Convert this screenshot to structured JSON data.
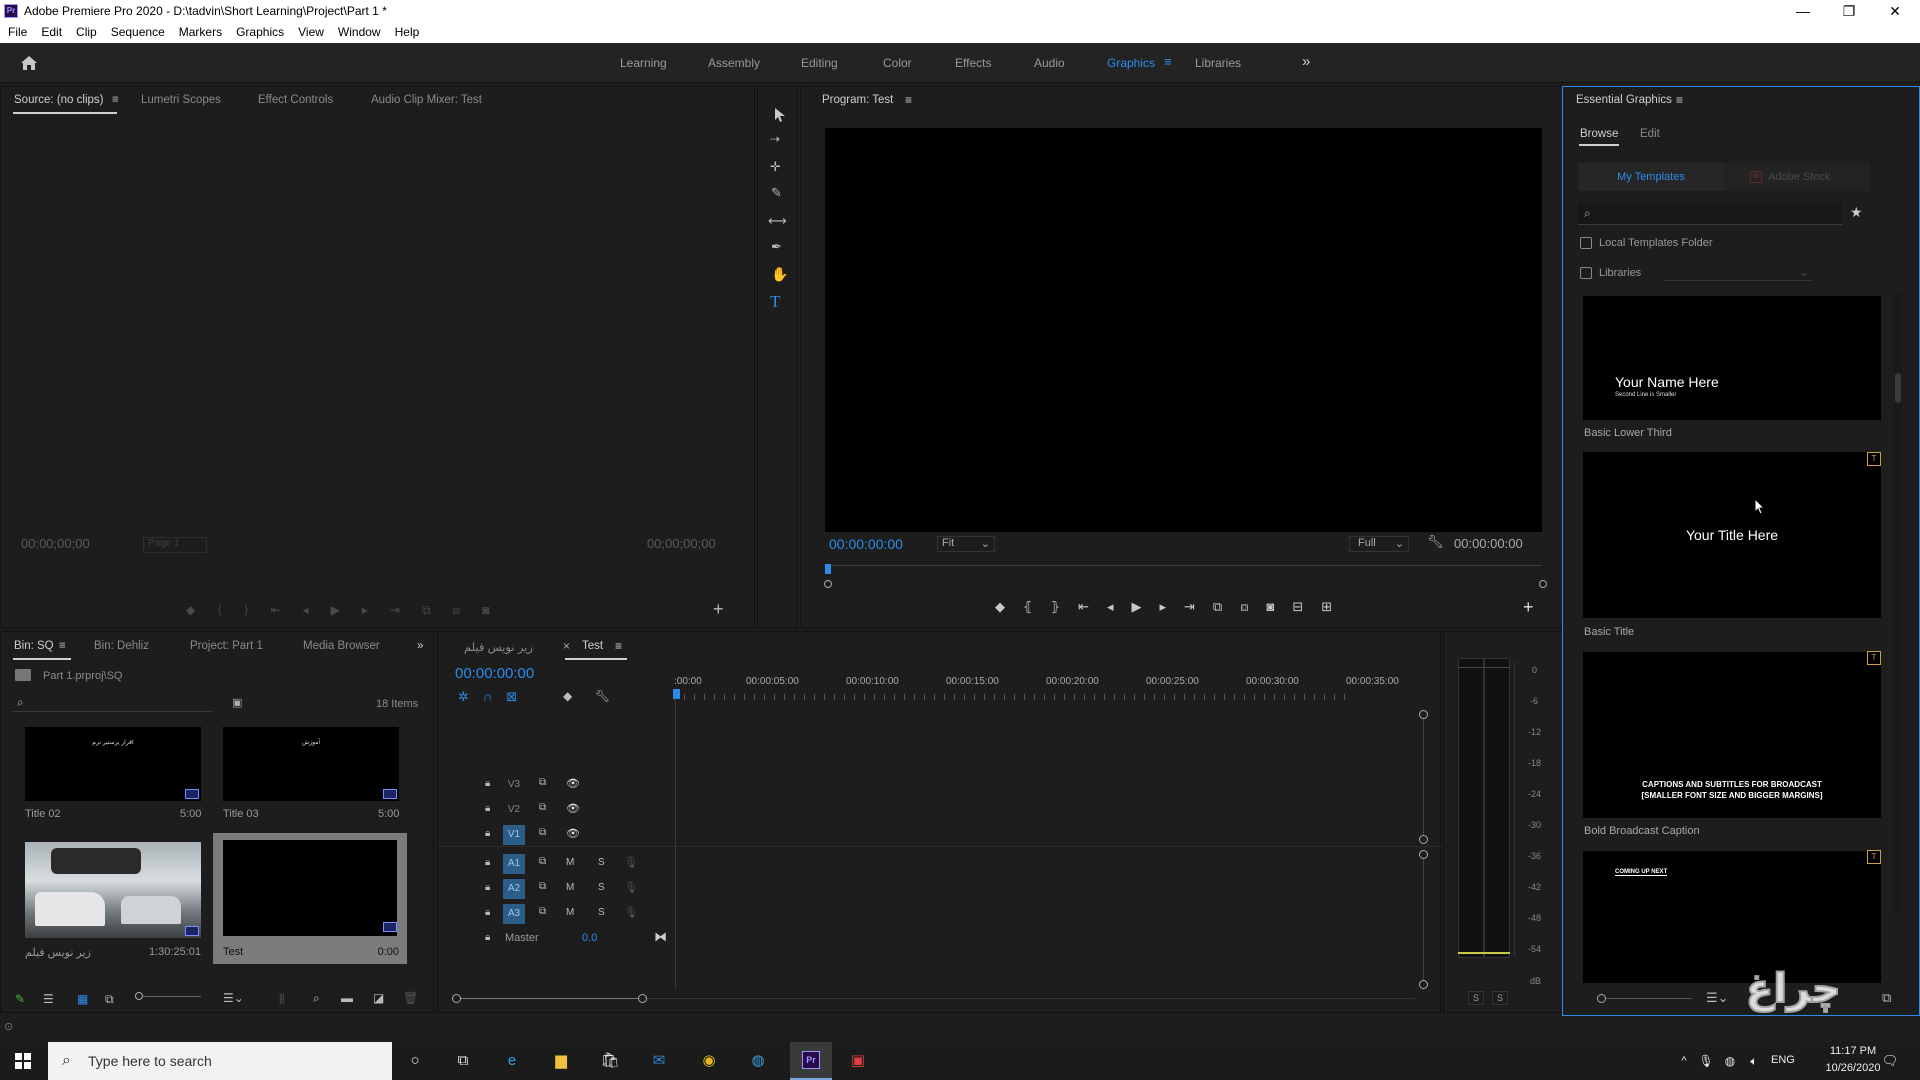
{
  "window": {
    "title": "Adobe Premiere Pro 2020 - D:\\tadvin\\Short Learning\\Project\\Part 1 *",
    "app_icon": "Pr",
    "controls": [
      "—",
      "❐",
      "✕"
    ]
  },
  "menu": [
    "File",
    "Edit",
    "Clip",
    "Sequence",
    "Markers",
    "Graphics",
    "View",
    "Window",
    "Help"
  ],
  "workspaces": {
    "tabs": [
      "Learning",
      "Assembly",
      "Editing",
      "Color",
      "Effects",
      "Audio",
      "Graphics",
      "Libraries"
    ],
    "active": "Graphics",
    "overflow": "»",
    "menu_icon": "≡"
  },
  "source_panel": {
    "tabs": [
      "Source: (no clips)",
      "Lumetri Scopes",
      "Effect Controls",
      "Audio Clip Mixer: Test"
    ],
    "tab_menu": "≡",
    "timecode_left": "00;00;00;00",
    "timecode_right": "00;00;00;00",
    "page_label": "Page 1"
  },
  "program_panel": {
    "title": "Program: Test",
    "timecode_left": "00:00:00:00",
    "fit": "Fit",
    "resolution": "Full",
    "timecode_right": "00:00:00:00"
  },
  "project_panel": {
    "tabs": [
      "Bin: SQ",
      "Bin: Dehliz",
      "Project: Part 1",
      "Media Browser"
    ],
    "path": "Part 1.prproj\\SQ",
    "item_count": "18 Items",
    "items": [
      {
        "name": "Title 02",
        "duration": "5:00",
        "thumb_text": "اقرار پرستیر نرم"
      },
      {
        "name": "Title 03",
        "duration": "5:00",
        "thumb_text": "آموزش"
      },
      {
        "name": "زیر نویس فیلم",
        "duration": "1:30:25:01",
        "thumb_text": ""
      },
      {
        "name": "Test",
        "duration": "0:00",
        "thumb_text": ""
      }
    ]
  },
  "timeline": {
    "tabs": [
      "زیر نویس فیلم",
      "Test"
    ],
    "close_icon": "×",
    "timecode": "00:00:00:00",
    "ruler": [
      ":00:00",
      "00:00:05:00",
      "00:00:10:00",
      "00:00:15:00",
      "00:00:20:00",
      "00:00:25:00",
      "00:00:30:00",
      "00:00:35:00"
    ],
    "video_tracks": [
      "V3",
      "V2",
      "V1"
    ],
    "audio_tracks": [
      "A1",
      "A2",
      "A3"
    ],
    "source_patch_selected": [
      "V1",
      "A1",
      "A2",
      "A3"
    ],
    "mute_label": "M",
    "solo_label": "S",
    "master_label": "Master",
    "master_value": "0.0"
  },
  "audio_meter": {
    "scale": [
      "0",
      "-6",
      "-12",
      "-18",
      "-24",
      "-30",
      "-36",
      "-42",
      "-48",
      "-54",
      "dB"
    ],
    "solo_buttons": [
      "S",
      "S"
    ]
  },
  "essential_graphics": {
    "title": "Essential Graphics",
    "tabs": [
      "Browse",
      "Edit"
    ],
    "source_tabs": [
      "My Templates",
      "Adobe Stock"
    ],
    "checkboxes": [
      "Local Templates Folder",
      "Libraries"
    ],
    "templates": [
      {
        "name": "Basic Lower Third",
        "preview_title": "Your Name Here",
        "preview_sub": "Second Line is Smaller"
      },
      {
        "name": "Basic Title",
        "preview_title": "Your Title Here"
      },
      {
        "name": "Bold Broadcast Caption",
        "preview_title": "CAPTIONS AND SUBTITLES FOR BROADCAST",
        "preview_sub": "[SMALLER FONT SIZE AND BIGGER MARGINS]"
      },
      {
        "name": "",
        "preview_title": "COMING UP NEXT"
      }
    ]
  },
  "watermark": "چراغ",
  "taskbar": {
    "search_placeholder": "Type here to search",
    "lang": "ENG",
    "time": "11:17 PM",
    "date": "10/26/2020"
  },
  "colors": {
    "accent": "#2d8ceb",
    "panel_bg": "#1d1d1d",
    "selected_track": "#2c5d86",
    "template_badge": "#c9a23c"
  }
}
